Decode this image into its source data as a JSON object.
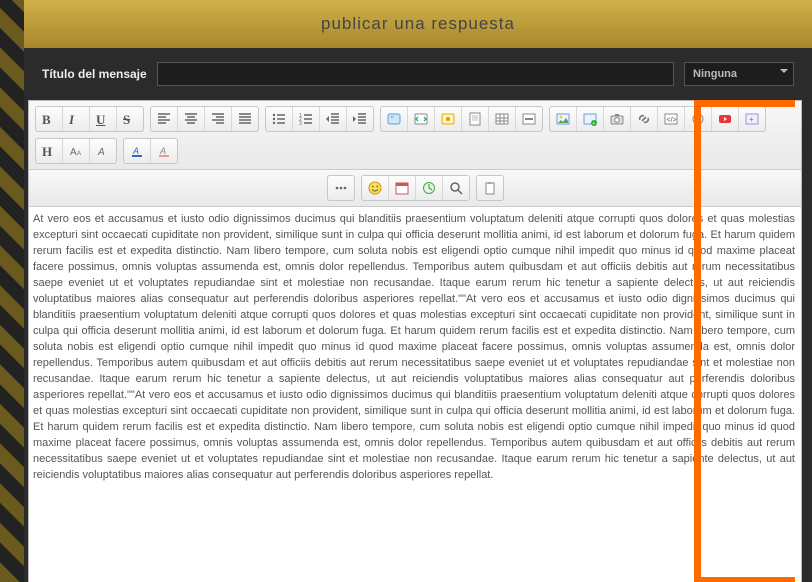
{
  "header": {
    "title": "publicar una respuesta"
  },
  "form": {
    "title_label": "Título del mensaje",
    "title_value": "",
    "icon_select": {
      "selected": "Ninguna"
    }
  },
  "toolbar": {
    "row1": [
      {
        "group": "format",
        "items": [
          {
            "name": "bold-button",
            "glyph": "B",
            "interact": true
          },
          {
            "name": "italic-button",
            "glyph": "I",
            "interact": true
          },
          {
            "name": "underline-button",
            "glyph": "U",
            "interact": true
          },
          {
            "name": "strike-button",
            "glyph": "S",
            "interact": true
          }
        ]
      },
      {
        "group": "align",
        "items": [
          {
            "name": "align-left-button",
            "icon": "align-left",
            "interact": true
          },
          {
            "name": "align-center-button",
            "icon": "align-center",
            "interact": true
          },
          {
            "name": "align-right-button",
            "icon": "align-right",
            "interact": true
          },
          {
            "name": "align-justify-button",
            "icon": "align-justify",
            "interact": true
          }
        ]
      },
      {
        "group": "list",
        "items": [
          {
            "name": "unordered-list-button",
            "icon": "list-ul",
            "interact": true
          },
          {
            "name": "ordered-list-button",
            "icon": "list-ol",
            "interact": true
          },
          {
            "name": "outdent-button",
            "icon": "outdent",
            "interact": true
          },
          {
            "name": "indent-button",
            "icon": "indent",
            "interact": true
          }
        ]
      },
      {
        "group": "insert1",
        "items": [
          {
            "name": "quote-button",
            "icon": "quote",
            "interact": true
          },
          {
            "name": "code-button",
            "icon": "code",
            "interact": true
          },
          {
            "name": "spoiler-button",
            "icon": "spoiler",
            "interact": true
          },
          {
            "name": "note-button",
            "icon": "note",
            "interact": true
          },
          {
            "name": "table-button",
            "icon": "table",
            "interact": true
          },
          {
            "name": "hr-button",
            "icon": "hr",
            "interact": true
          }
        ]
      },
      {
        "group": "media",
        "items": [
          {
            "name": "image-button",
            "icon": "image",
            "interact": true
          },
          {
            "name": "image-host-button",
            "icon": "image2",
            "interact": true
          },
          {
            "name": "screenshot-button",
            "icon": "camera",
            "interact": true
          },
          {
            "name": "link-button",
            "icon": "link",
            "interact": true
          },
          {
            "name": "embed-button",
            "icon": "embed",
            "interact": true
          },
          {
            "name": "anchor-button",
            "icon": "anchor",
            "interact": true
          },
          {
            "name": "youtube-button",
            "icon": "youtube",
            "interact": true
          },
          {
            "name": "media-plus-button",
            "icon": "mediaplus",
            "interact": true
          }
        ]
      },
      {
        "group": "heading",
        "items": [
          {
            "name": "heading-button",
            "glyph": "H",
            "interact": true
          },
          {
            "name": "font-size-button",
            "icon": "fontsize",
            "interact": true
          },
          {
            "name": "font-family-button",
            "icon": "fontfam",
            "interact": true
          }
        ]
      },
      {
        "group": "color",
        "items": [
          {
            "name": "font-color-button",
            "icon": "fontcolor",
            "interact": true
          },
          {
            "name": "highlight-color-button",
            "icon": "hilite",
            "interact": true
          }
        ]
      }
    ],
    "row2": [
      {
        "group": "extras",
        "items": [
          {
            "name": "more-button",
            "icon": "more",
            "interact": true
          }
        ]
      },
      {
        "group": "emoji",
        "items": [
          {
            "name": "emoji-button",
            "icon": "emoji",
            "interact": true
          },
          {
            "name": "date-button",
            "icon": "date",
            "interact": true
          },
          {
            "name": "time-button",
            "icon": "time",
            "interact": true
          },
          {
            "name": "search-button",
            "icon": "search",
            "interact": true
          }
        ]
      },
      {
        "group": "clipboard",
        "items": [
          {
            "name": "paste-button",
            "icon": "paste",
            "interact": true
          }
        ]
      }
    ]
  },
  "content": {
    "text": "At vero eos et accusamus et iusto odio dignissimos ducimus qui blanditiis praesentium voluptatum deleniti atque corrupti quos dolores et quas molestias excepturi sint occaecati cupiditate non provident, similique sunt in culpa qui officia deserunt mollitia animi, id est laborum et dolorum fuga. Et harum quidem rerum facilis est et expedita distinctio. Nam libero tempore, cum soluta nobis est eligendi optio cumque nihil impedit quo minus id quod maxime placeat facere possimus, omnis voluptas assumenda est, omnis dolor repellendus. Temporibus autem quibusdam et aut officiis debitis aut rerum necessitatibus saepe eveniet ut et voluptates repudiandae sint et molestiae non recusandae. Itaque earum rerum hic tenetur a sapiente delectus, ut aut reiciendis voluptatibus maiores alias consequatur aut perferendis doloribus asperiores repellat.\"\"At vero eos et accusamus et iusto odio dignissimos ducimus qui blanditiis praesentium voluptatum deleniti atque corrupti quos dolores et quas molestias excepturi sint occaecati cupiditate non provident, similique sunt in culpa qui officia deserunt mollitia animi, id est laborum et dolorum fuga. Et harum quidem rerum facilis est et expedita distinctio. Nam libero tempore, cum soluta nobis est eligendi optio cumque nihil impedit quo minus id quod maxime placeat facere possimus, omnis voluptas assumenda est, omnis dolor repellendus. Temporibus autem quibusdam et aut officiis debitis aut rerum necessitatibus saepe eveniet ut et voluptates repudiandae sint et molestiae non recusandae. Itaque earum rerum hic tenetur a sapiente delectus, ut aut reiciendis voluptatibus maiores alias consequatur aut perferendis doloribus asperiores repellat.\"\"At vero eos et accusamus et iusto odio dignissimos ducimus qui blanditiis praesentium voluptatum deleniti atque corrupti quos dolores et quas molestias excepturi sint occaecati cupiditate non provident, similique sunt in culpa qui officia deserunt mollitia animi, id est laborum et dolorum fuga. Et harum quidem rerum facilis est et expedita distinctio. Nam libero tempore, cum soluta nobis est eligendi optio cumque nihil impedit quo minus id quod maxime placeat facere possimus, omnis voluptas assumenda est, omnis dolor repellendus. Temporibus autem quibusdam et aut officiis debitis aut rerum necessitatibus saepe eveniet ut et voluptates repudiandae sint et molestiae non recusandae. Itaque earum rerum hic tenetur a sapiente delectus, ut aut reiciendis voluptatibus maiores alias consequatur aut perferendis doloribus asperiores repellat."
  },
  "icons": {
    "align-left": "<svg viewBox='0 0 14 14'><path stroke='#666' stroke-width='1.4' d='M1 2h12M1 5h8M1 8h12M1 11h8'/></svg>",
    "align-center": "<svg viewBox='0 0 14 14'><path stroke='#666' stroke-width='1.4' d='M1 2h12M3 5h8M1 8h12M3 11h8'/></svg>",
    "align-right": "<svg viewBox='0 0 14 14'><path stroke='#666' stroke-width='1.4' d='M1 2h12M5 5h8M1 8h12M5 11h8'/></svg>",
    "align-justify": "<svg viewBox='0 0 14 14'><path stroke='#666' stroke-width='1.4' d='M1 2h12M1 5h12M1 8h12M1 11h12'/></svg>",
    "list-ul": "<svg viewBox='0 0 14 14'><circle cx='2' cy='3' r='1.2' fill='#666'/><circle cx='2' cy='7' r='1.2' fill='#666'/><circle cx='2' cy='11' r='1.2' fill='#666'/><path stroke='#666' stroke-width='1.4' d='M5 3h8M5 7h8M5 11h8'/></svg>",
    "list-ol": "<svg viewBox='0 0 14 14'><text x='0' y='5' font-size='5' fill='#666'>1</text><text x='0' y='9' font-size='5' fill='#666'>2</text><text x='0' y='13' font-size='5' fill='#666'>3</text><path stroke='#666' stroke-width='1.4' d='M5 3h8M5 7h8M5 11h8'/></svg>",
    "outdent": "<svg viewBox='0 0 14 14'><path stroke='#666' stroke-width='1.4' d='M5 2h8M5 5h8M5 8h8M5 11h8'/><path fill='#666' d='M3 4L0 7l3 3z'/></svg>",
    "indent": "<svg viewBox='0 0 14 14'><path stroke='#666' stroke-width='1.4' d='M5 2h8M5 5h8M5 8h8M5 11h8'/><path fill='#666' d='M0 4l3 3-3 3z'/></svg>",
    "quote": "<svg viewBox='0 0 14 14'><rect x='1' y='2' width='12' height='10' rx='2' fill='#cfe6f7' stroke='#5aa0d8'/><text x='4' y='10' font-size='8' fill='#3b79b5'>”</text></svg>",
    "code": "<svg viewBox='0 0 14 14'><rect x='1' y='2' width='12' height='10' rx='1' fill='#fff' stroke='#888'/><path stroke='#2a7' stroke-width='1.3' fill='none' d='M4 5l-2 2 2 2M10 5l2 2-2 2'/></svg>",
    "spoiler": "<svg viewBox='0 0 14 14'><rect x='1' y='2' width='12' height='10' rx='1' fill='#fff3c4' stroke='#d8b200'/><circle cx='7' cy='7' r='2' fill='#d89e00'/></svg>",
    "note": "<svg viewBox='0 0 14 14'><rect x='2' y='1' width='10' height='12' fill='#fff' stroke='#888'/><path stroke='#bbb' d='M4 4h6M4 6h6M4 8h6'/></svg>",
    "table": "<svg viewBox='0 0 14 14'><rect x='1' y='2' width='12' height='10' fill='#fff' stroke='#888'/><path stroke='#888' d='M1 6h12M1 9h12M5 2v10M9 2v10'/></svg>",
    "hr": "<svg viewBox='0 0 14 14'><rect x='1' y='2' width='12' height='10' fill='#fff' stroke='#888'/><path stroke='#666' stroke-width='1.6' d='M3 7h8'/></svg>",
    "image": "<svg viewBox='0 0 14 14'><rect x='1' y='2' width='12' height='10' fill='#eaf3ff' stroke='#6aa0d8'/><circle cx='5' cy='5' r='1.3' fill='#f4c430'/><path fill='#5aa05a' d='M2 11l3-3 2 2 3-4 2 3v2H2z'/></svg>",
    "image2": "<svg viewBox='0 0 14 14'><rect x='1' y='2' width='12' height='10' fill='#eaf3ff' stroke='#6aa0d8'/><circle cx='11' cy='11' r='3' fill='#3a3'/><text x='9.3' y='13' font-size='5' fill='#fff'>+</text></svg>",
    "camera": "<svg viewBox='0 0 14 14'><rect x='1' y='4' width='12' height='8' rx='1' fill='#ddd' stroke='#888'/><rect x='5' y='2' width='4' height='2' fill='#888'/><circle cx='7' cy='8' r='2.3' fill='#fff' stroke='#888'/></svg>",
    "link": "<svg viewBox='0 0 14 14'><path fill='none' stroke='#777' stroke-width='1.6' d='M5 9l4-4M3 8a3 3 0 0 1 4-4M11 6a3 3 0 0 1-4 4'/></svg>",
    "embed": "<svg viewBox='0 0 14 14'><rect x='1' y='2' width='12' height='10' fill='#fff' stroke='#888'/><text x='2.5' y='10' font-size='7' fill='#555'>&lt;/&gt;</text></svg>",
    "anchor": "<svg viewBox='0 0 14 14'><circle cx='7' cy='7' r='5' fill='none' stroke='#888'/><circle cx='7' cy='7' r='2' fill='#888'/></svg>",
    "youtube": "<svg viewBox='0 0 14 14'><rect x='1' y='3' width='12' height='8' rx='2' fill='#e33'/><path fill='#fff' d='M6 5v4l3-2z'/></svg>",
    "mediaplus": "<svg viewBox='0 0 14 14'><rect x='1' y='2' width='12' height='10' fill='#eef' stroke='#99c'/><text x='4' y='10' font-size='8' fill='#3a3'>+</text></svg>",
    "fontsize": "<svg viewBox='0 0 14 14'><text x='1' y='11' font-size='10' fill='#666'>A</text><text x='8' y='11' font-size='6' fill='#666'>A</text></svg>",
    "fontfam": "<svg viewBox='0 0 14 14'><text x='2' y='11' font-size='10' font-style='italic' fill='#666'>A</text></svg>",
    "fontcolor": "<svg viewBox='0 0 14 14'><text x='3' y='10' font-size='9' font-style='italic' fill='#36c'>A</text><rect x='2' y='11' width='10' height='2' fill='#36c'/></svg>",
    "hilite": "<svg viewBox='0 0 14 14'><text x='3' y='10' font-size='9' font-style='italic' fill='#888'>A</text><rect x='2' y='11' width='10' height='2' fill='#e99'/></svg>",
    "more": "<svg viewBox='0 0 14 14'><circle cx='3' cy='7' r='1.3' fill='#666'/><circle cx='7' cy='7' r='1.3' fill='#666'/><circle cx='11' cy='7' r='1.3' fill='#666'/></svg>",
    "emoji": "<svg viewBox='0 0 14 14'><circle cx='7' cy='7' r='6' fill='#ffdd55' stroke='#cc9900'/><circle cx='4.8' cy='5.5' r='0.9' fill='#663'/><circle cx='9.2' cy='5.5' r='0.9' fill='#663'/><path stroke='#663' stroke-width='1.2' fill='none' d='M4 8.5q3 3 6 0'/></svg>",
    "date": "<svg viewBox='0 0 14 14'><rect x='1' y='2' width='12' height='11' fill='#fff' stroke='#c55'/><rect x='1' y='2' width='12' height='3' fill='#c55'/></svg>",
    "time": "<svg viewBox='0 0 14 14'><circle cx='7' cy='7' r='5.5' fill='#e8f4e8' stroke='#4a4'/><path stroke='#4a4' stroke-width='1.2' d='M7 7V3M7 7l3 2'/></svg>",
    "search": "<svg viewBox='0 0 14 14'><circle cx='6' cy='6' r='4' fill='none' stroke='#666' stroke-width='1.5'/><path stroke='#666' stroke-width='1.5' d='M9 9l4 4'/></svg>",
    "paste": "<svg viewBox='0 0 14 14'><rect x='3' y='2' width='8' height='11' fill='#fff' stroke='#888'/><rect x='5' y='1' width='4' height='2' fill='#aaa'/></svg>"
  }
}
